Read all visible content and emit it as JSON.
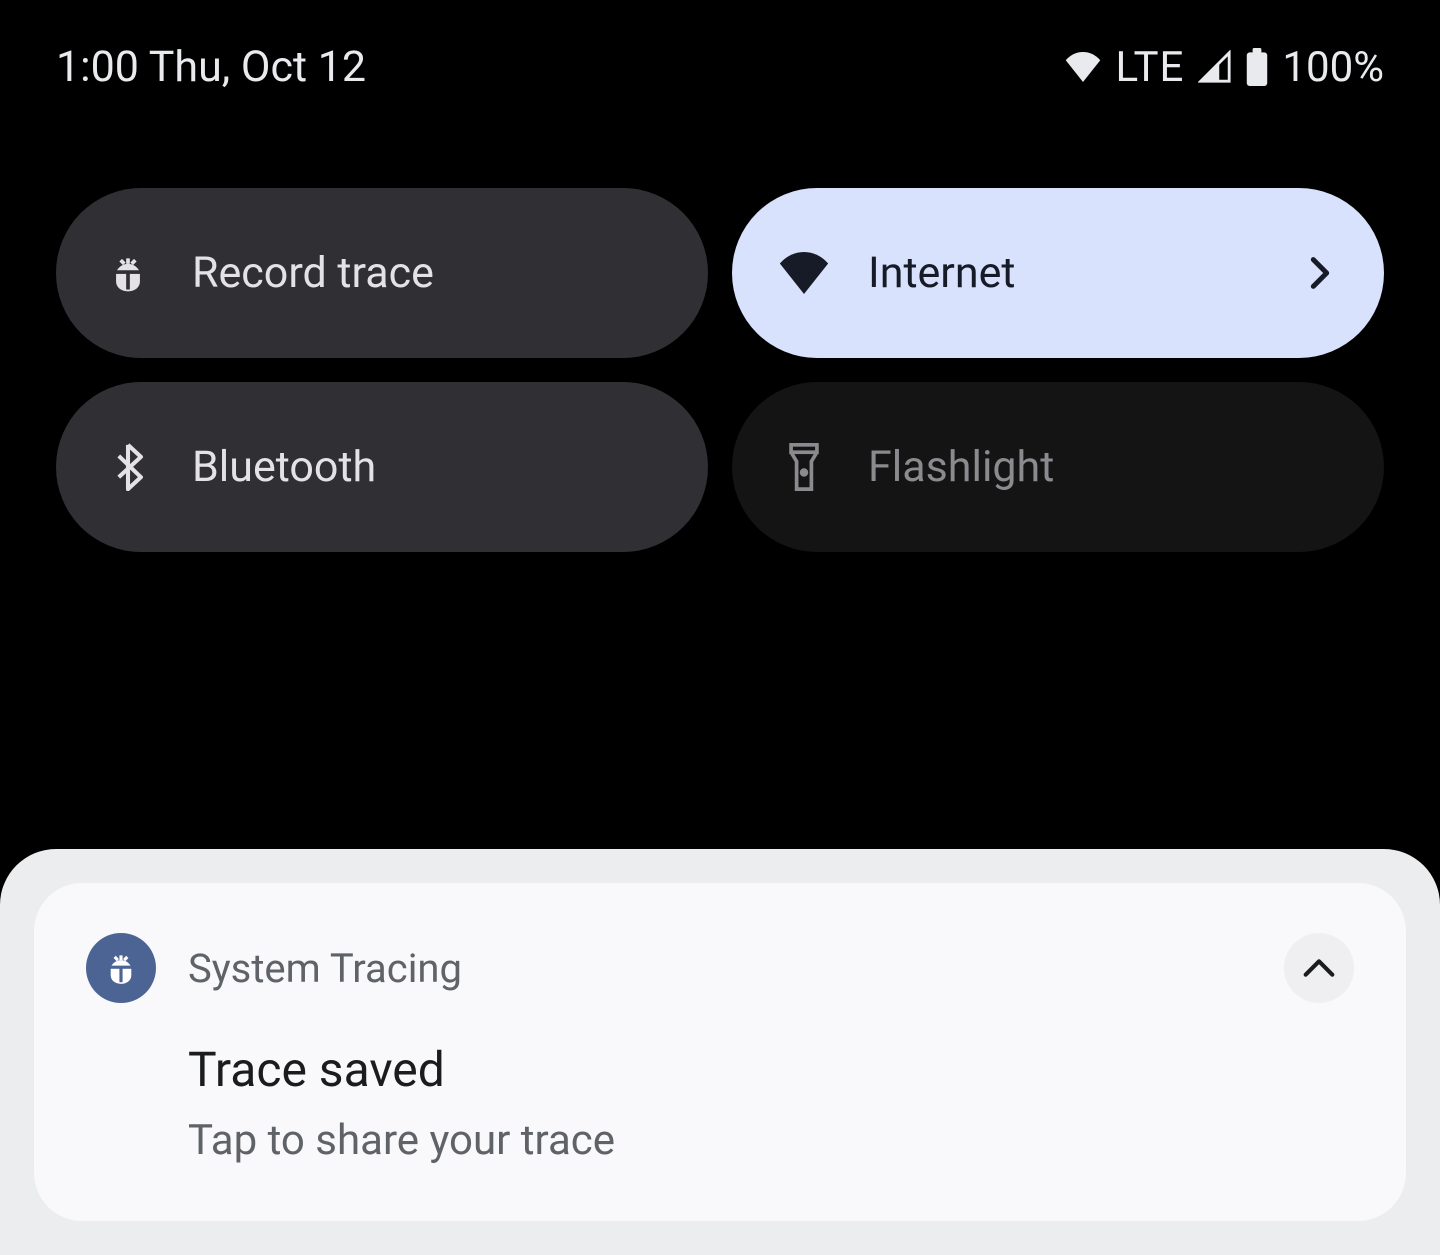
{
  "status_bar": {
    "time_date": "1:00 Thu, Oct 12",
    "mobile_label": "LTE",
    "battery_pct": "100%"
  },
  "quick_settings": {
    "tiles": [
      {
        "label": "Record trace",
        "state": "inactive",
        "icon": "bug-icon"
      },
      {
        "label": "Internet",
        "state": "active",
        "icon": "wifi-icon",
        "has_chevron": true
      },
      {
        "label": "Bluetooth",
        "state": "inactive",
        "icon": "bluetooth-icon"
      },
      {
        "label": "Flashlight",
        "state": "disabled",
        "icon": "flashlight-icon"
      }
    ]
  },
  "notification": {
    "app_name": "System Tracing",
    "title": "Trace saved",
    "text": "Tap to share your trace"
  }
}
